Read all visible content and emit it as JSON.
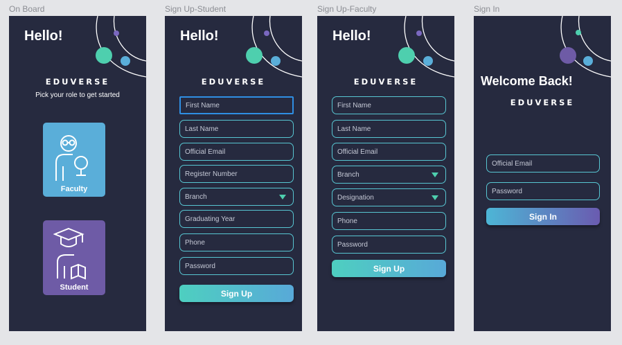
{
  "frames": [
    {
      "title": "On Board"
    },
    {
      "title": "Sign Up-Student"
    },
    {
      "title": "Sign Up-Faculty"
    },
    {
      "title": "Sign In"
    }
  ],
  "onboard": {
    "greeting": "Hello!",
    "brand": "EDUVERSE",
    "tagline": "Pick your role to get started",
    "faculty_label": "Faculty",
    "student_label": "Student"
  },
  "student": {
    "greeting": "Hello!",
    "brand": "EDUVERSE",
    "fields": {
      "first_name": "First Name",
      "last_name": "Last Name",
      "email": "Official Email",
      "register_number": "Register Number",
      "branch": "Branch",
      "graduating_year": "Graduating Year",
      "phone": "Phone",
      "password": "Password"
    },
    "submit": "Sign Up"
  },
  "faculty": {
    "greeting": "Hello!",
    "brand": "EDUVERSE",
    "fields": {
      "first_name": "First Name",
      "last_name": "Last Name",
      "email": "Official Email",
      "branch": "Branch",
      "designation": "Designation",
      "phone": "Phone",
      "password": "Password"
    },
    "submit": "Sign Up"
  },
  "signin": {
    "greeting": "Welcome Back!",
    "brand": "EDUVERSE",
    "fields": {
      "email": "Official Email",
      "password": "Password"
    },
    "submit": "Sign In"
  },
  "colors": {
    "background": "#e4e5e8",
    "panel": "#262a3f",
    "field_border": "#58c7d3",
    "focus_border": "#2f8fe4",
    "teal": "#4ecfae",
    "faculty_card": "#5aaed9",
    "student_card": "#6e5ba6",
    "caret": "#4ecfae"
  }
}
